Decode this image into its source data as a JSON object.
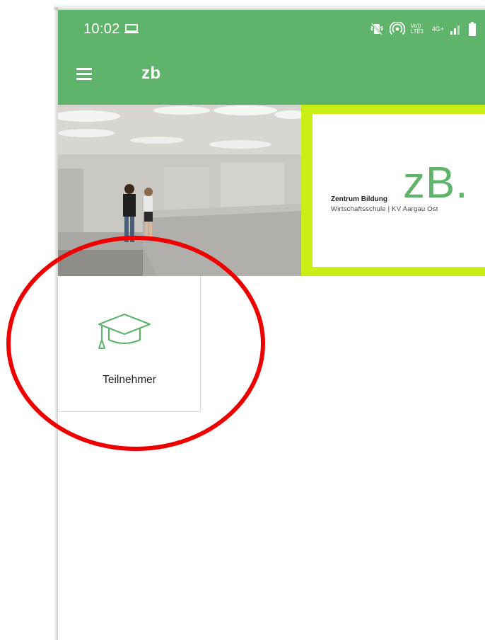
{
  "status_bar": {
    "time": "10:02",
    "laptop_icon": "laptop-icon",
    "mute_icon": "vibrate-off-icon",
    "hotspot_icon": "hotspot-icon",
    "volte_text": "Vo)) LTE1",
    "network_text": "4G+",
    "signal_icon": "signal-icon",
    "battery_icon": "battery-icon"
  },
  "app_bar": {
    "menu_icon": "menu-icon",
    "title": "zb"
  },
  "hero": {
    "photo": "school-interior-photo",
    "logo": {
      "mark": "zB.",
      "line1": "Zentrum Bildung",
      "line2": "Wirtschaftsschule | KV Aargau Ost"
    }
  },
  "tile": {
    "icon": "graduation-cap-icon",
    "label": "Teilnehmer"
  },
  "colors": {
    "primary": "#5fb36a",
    "logo_border": "#c8ee16",
    "annotation": "#ee0000"
  }
}
